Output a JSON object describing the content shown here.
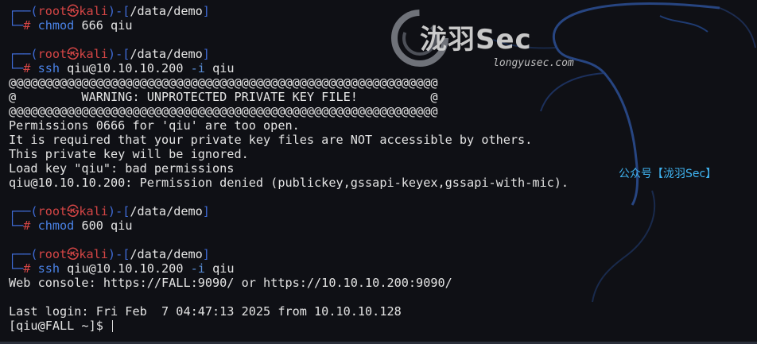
{
  "watermark": {
    "brand": "泷羽Sec",
    "url": "longyusec.com",
    "side": "公众号【泷羽Sec】"
  },
  "prompt": {
    "user": "root",
    "at": "㉿",
    "host": "kali",
    "path": "/data/demo"
  },
  "commands": [
    {
      "cmd": "chmod",
      "args": " 666 qiu",
      "flag": "",
      "after": ""
    },
    {
      "cmd": "ssh",
      "args": " qiu@10.10.10.200 ",
      "flag": "-i",
      "after": " qiu"
    },
    {
      "cmd": "chmod",
      "args": " 600 qiu",
      "flag": "",
      "after": ""
    },
    {
      "cmd": "ssh",
      "args": " qiu@10.10.10.200 ",
      "flag": "-i",
      "after": " qiu"
    }
  ],
  "output1": [
    "@@@@@@@@@@@@@@@@@@@@@@@@@@@@@@@@@@@@@@@@@@@@@@@@@@@@@@@@@@@",
    "@         WARNING: UNPROTECTED PRIVATE KEY FILE!          @",
    "@@@@@@@@@@@@@@@@@@@@@@@@@@@@@@@@@@@@@@@@@@@@@@@@@@@@@@@@@@@",
    "Permissions 0666 for 'qiu' are too open.",
    "It is required that your private key files are NOT accessible by others.",
    "This private key will be ignored.",
    "Load key \"qiu\": bad permissions",
    "qiu@10.10.10.200: Permission denied (publickey,gssapi-keyex,gssapi-with-mic)."
  ],
  "output2": [
    "Web console: https://FALL:9090/ or https://10.10.10.200:9090/",
    "",
    "Last login: Fri Feb  7 04:47:13 2025 from 10.10.10.128"
  ],
  "final_prompt": "[qiu@FALL ~]$ "
}
